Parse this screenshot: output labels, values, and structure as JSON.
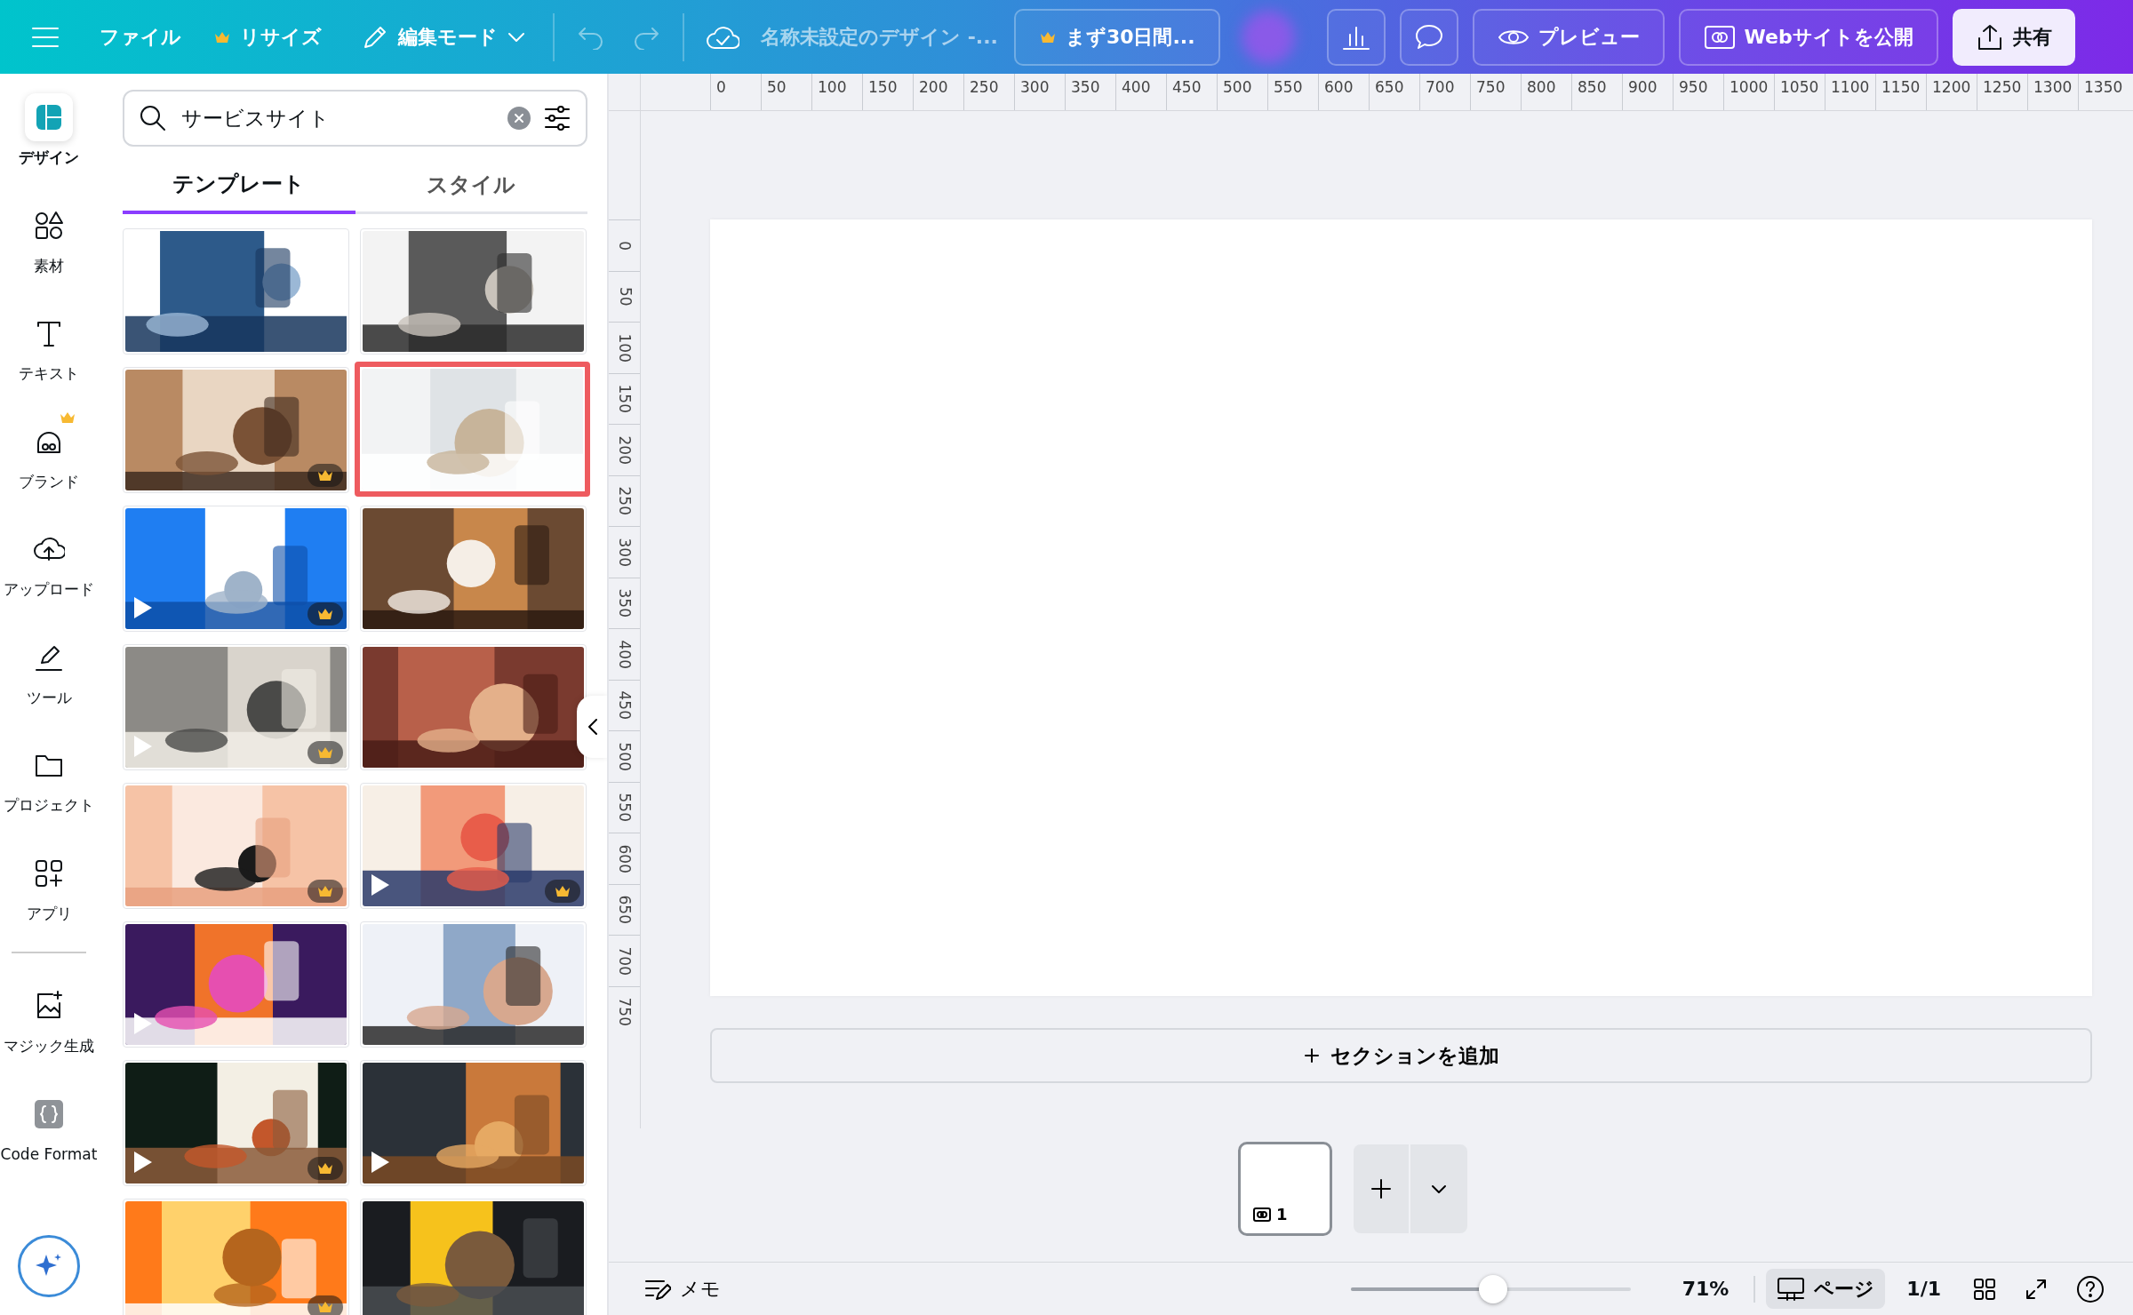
{
  "topbar": {
    "file_menu": "ファイル",
    "resize": {
      "label": "リサイズ",
      "premium": true
    },
    "edit_mode": "編集モード",
    "undo": {
      "disabled": true
    },
    "redo": {
      "disabled": true
    },
    "document_title": "名称未設定のデザイン -...",
    "trial_button": {
      "label": "まず30日間...",
      "premium": true
    },
    "preview": "プレビュー",
    "publish": "Webサイトを公開",
    "share": "共有"
  },
  "rail": {
    "items": [
      {
        "label": "デザイン",
        "selected": true,
        "premium": false
      },
      {
        "label": "素材",
        "selected": false,
        "premium": false
      },
      {
        "label": "テキスト",
        "selected": false,
        "premium": false
      },
      {
        "label": "ブランド",
        "selected": false,
        "premium": true
      },
      {
        "label": "アップロード",
        "selected": false,
        "premium": false
      },
      {
        "label": "ツール",
        "selected": false,
        "premium": false
      },
      {
        "label": "プロジェクト",
        "selected": false,
        "premium": false
      },
      {
        "label": "アプリ",
        "selected": false,
        "premium": false
      }
    ],
    "extra_items": [
      {
        "label": "マジック生成",
        "selected": false,
        "premium": false
      },
      {
        "label": "Code Format",
        "selected": false,
        "premium": false
      }
    ]
  },
  "panel": {
    "search": {
      "value": "サービスサイト"
    },
    "tabs": [
      {
        "label": "テンプレート",
        "selected": true
      },
      {
        "label": "スタイル",
        "selected": false
      }
    ],
    "templates": [
      {
        "kind": "picture",
        "premium": false,
        "video": false,
        "highlighted": false
      },
      {
        "kind": "picture",
        "premium": false,
        "video": false,
        "highlighted": false
      },
      {
        "kind": "picture",
        "premium": true,
        "video": false,
        "highlighted": false
      },
      {
        "kind": "picture",
        "premium": false,
        "video": false,
        "highlighted": true
      },
      {
        "kind": "picture",
        "premium": true,
        "video": true,
        "highlighted": false
      },
      {
        "kind": "picture",
        "premium": false,
        "video": false,
        "highlighted": false
      },
      {
        "kind": "picture",
        "premium": true,
        "video": true,
        "highlighted": false
      },
      {
        "kind": "picture",
        "premium": false,
        "video": false,
        "highlighted": false
      },
      {
        "kind": "picture",
        "premium": true,
        "video": false,
        "highlighted": false
      },
      {
        "kind": "picture",
        "premium": true,
        "video": true,
        "highlighted": false
      },
      {
        "kind": "picture",
        "premium": false,
        "video": true,
        "highlighted": false
      },
      {
        "kind": "picture",
        "premium": false,
        "video": false,
        "highlighted": false
      },
      {
        "kind": "picture",
        "premium": true,
        "video": true,
        "highlighted": false
      },
      {
        "kind": "picture",
        "premium": false,
        "video": true,
        "highlighted": false
      },
      {
        "kind": "picture",
        "premium": true,
        "video": false,
        "highlighted": false
      },
      {
        "kind": "picture",
        "premium": false,
        "video": false,
        "highlighted": false
      }
    ]
  },
  "rulers": {
    "horizontal": [
      "0",
      "50",
      "100",
      "150",
      "200",
      "250",
      "300",
      "350",
      "400",
      "450",
      "500",
      "550",
      "600",
      "650",
      "700",
      "750",
      "800",
      "850",
      "900",
      "950",
      "1000",
      "1050",
      "1100",
      "1150",
      "1200",
      "1250",
      "1300",
      "1350"
    ],
    "vertical": [
      "0",
      "50",
      "100",
      "150",
      "200",
      "250",
      "300",
      "350",
      "400",
      "450",
      "500",
      "550",
      "600",
      "650",
      "700",
      "750"
    ]
  },
  "canvas": {
    "add_section": "セクションを追加"
  },
  "pages": [
    {
      "number": "1",
      "selected": true
    }
  ],
  "bottom_bar": {
    "notes": "メモ",
    "zoom": {
      "level": 0.51
    },
    "zoom_text": "71%",
    "page_view": {
      "label": "ページ",
      "selected": true
    },
    "page_count": "1/1"
  }
}
